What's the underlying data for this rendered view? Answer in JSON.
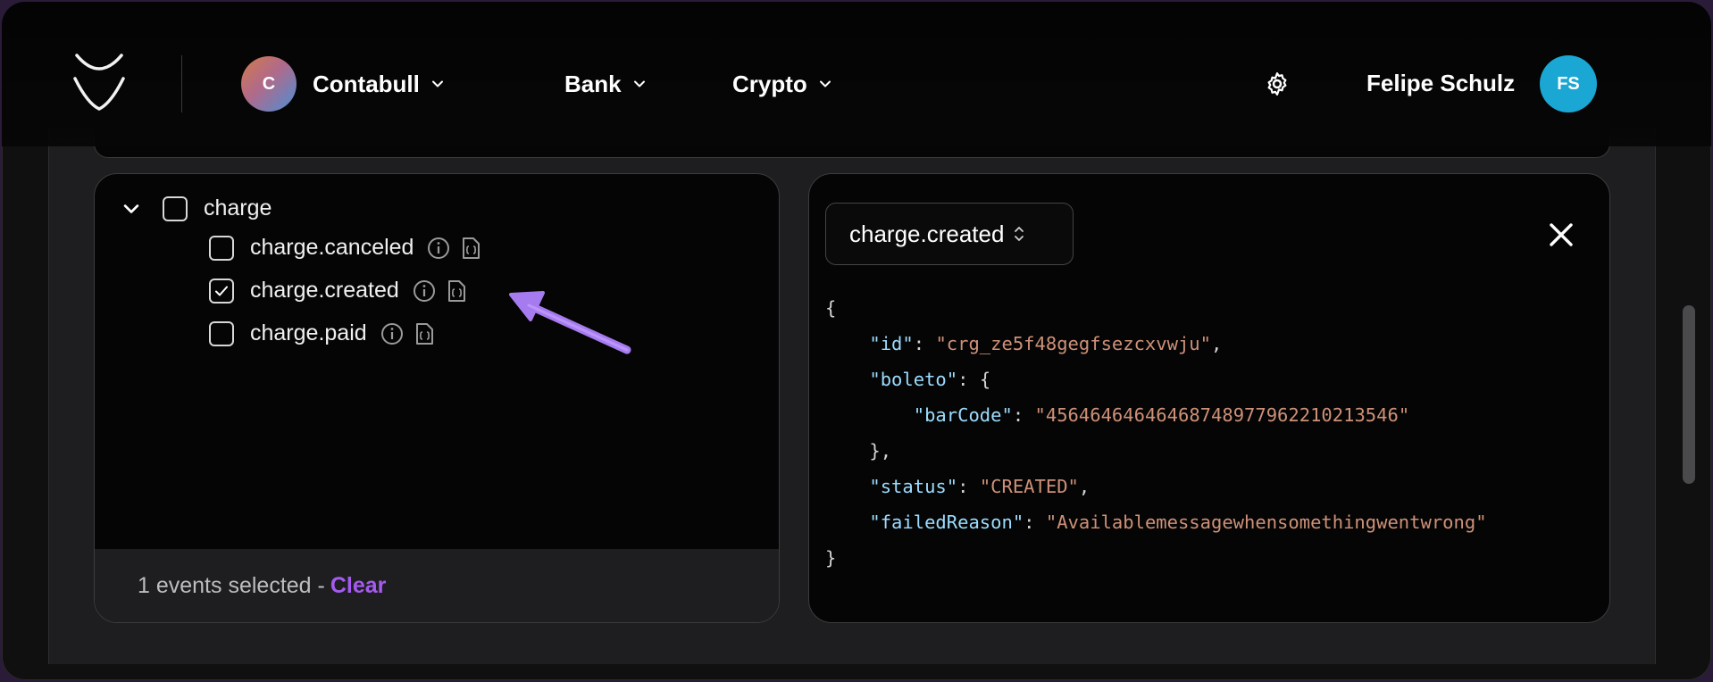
{
  "header": {
    "org_name": "Contabull",
    "org_initial": "C",
    "nav": [
      {
        "label": "Bank"
      },
      {
        "label": "Crypto"
      }
    ],
    "user_name": "Felipe Schulz",
    "user_initials": "FS",
    "icons": [
      "logo-icon",
      "chevron-down-icon",
      "gear-icon"
    ]
  },
  "events": {
    "group_label": "charge",
    "items": [
      {
        "label": "charge.canceled",
        "checked": false
      },
      {
        "label": "charge.created",
        "checked": true
      },
      {
        "label": "charge.paid",
        "checked": false
      }
    ],
    "footer_count": "1 events selected -",
    "footer_clear": "Clear"
  },
  "preview": {
    "selected_event": "charge.created",
    "json_lines": [
      {
        "indent": 0,
        "text": "{"
      },
      {
        "indent": 1,
        "key": "\"id\"",
        "sep": ": ",
        "value": "\"crg_ze5f48gegfsezcxvwju\"",
        "tail": ","
      },
      {
        "indent": 1,
        "key": "\"boleto\"",
        "sep": ": ",
        "value": "",
        "tail": "{"
      },
      {
        "indent": 2,
        "key": "\"barCode\"",
        "sep": ": ",
        "value": "\"456464646464687489779622102135 46\"",
        "tail": ""
      },
      {
        "indent": 1,
        "text": "},"
      },
      {
        "indent": 1,
        "key": "\"status\"",
        "sep": ": ",
        "value": "\"CREATED\"",
        "tail": ","
      },
      {
        "indent": 1,
        "key": "\"failedReason\"",
        "sep": ": ",
        "value": "\"Available message when something went wrong\"",
        "tail": ""
      },
      {
        "indent": 0,
        "text": "}"
      }
    ]
  },
  "colors": {
    "accent": "#a55bf0",
    "json_key": "#9cdcfe",
    "json_string": "#ce9178",
    "user_avatar": "#1aa7d4"
  }
}
